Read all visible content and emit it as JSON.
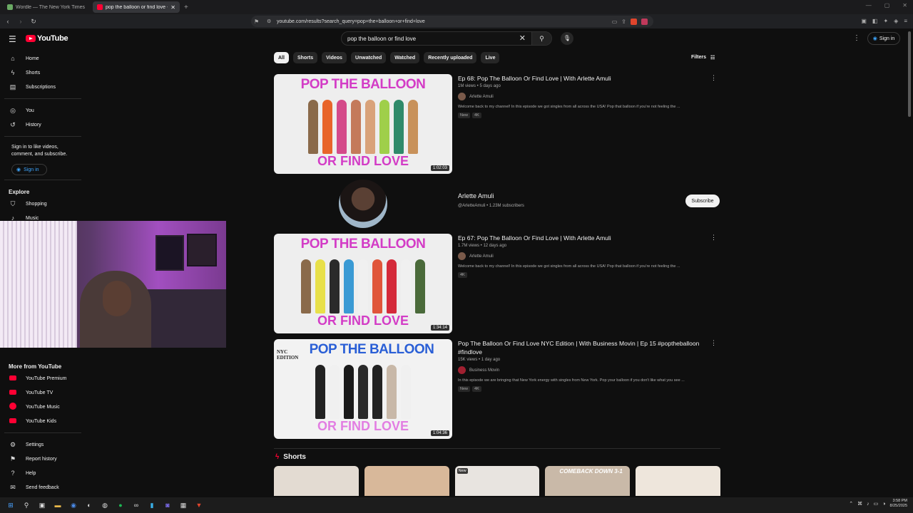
{
  "browser": {
    "tabs": [
      {
        "title": "Wordle — The New York Times",
        "active": false
      },
      {
        "title": "pop the balloon or find love - Yo",
        "active": true
      }
    ],
    "url": "youtube.com/results?search_query=pop+the+balloon+or+find+love"
  },
  "header": {
    "logo_text": "YouTube",
    "search_value": "pop the balloon or find love",
    "sign_in": "Sign in"
  },
  "sidebar": {
    "main": [
      {
        "label": "Home",
        "icon": "home-icon"
      },
      {
        "label": "Shorts",
        "icon": "shorts-icon"
      },
      {
        "label": "Subscriptions",
        "icon": "subscriptions-icon"
      }
    ],
    "you": [
      {
        "label": "You",
        "icon": "user-icon"
      },
      {
        "label": "History",
        "icon": "history-icon"
      }
    ],
    "signin_note": "Sign in to like videos, comment, and subscribe.",
    "signin_btn": "Sign in",
    "explore_title": "Explore",
    "explore": [
      {
        "label": "Shopping",
        "icon": "bag-icon"
      },
      {
        "label": "Music",
        "icon": "music-icon"
      }
    ],
    "more_title": "More from YouTube",
    "more": [
      {
        "label": "YouTube Premium"
      },
      {
        "label": "YouTube TV"
      },
      {
        "label": "YouTube Music"
      },
      {
        "label": "YouTube Kids"
      }
    ],
    "bottom": [
      {
        "label": "Settings",
        "icon": "gear-icon"
      },
      {
        "label": "Report history",
        "icon": "flag-icon"
      },
      {
        "label": "Help",
        "icon": "help-icon"
      },
      {
        "label": "Send feedback",
        "icon": "feedback-icon"
      }
    ]
  },
  "chips": [
    "All",
    "Shorts",
    "Videos",
    "Unwatched",
    "Watched",
    "Recently uploaded",
    "Live"
  ],
  "filters_label": "Filters",
  "results": [
    {
      "thumb_top": "POP THE BALLOON",
      "thumb_bottom": "OR FIND LOVE",
      "duration": "1:02:03",
      "title": "Ep 68: Pop The Balloon Or Find Love | With Arlette Amuli",
      "meta": "1M views • 5 days ago",
      "channel": "Arlette Amuli",
      "desc": "Welcome back to my channel! In this episode we got singles from all across the USA! Pop that balloon if you're not feeling the ...",
      "badges": [
        "New",
        "4K"
      ]
    },
    {
      "thumb_top": "POP THE BALLOON",
      "thumb_bottom": "OR FIND LOVE",
      "duration": "1:34:14",
      "title": "Ep 67: Pop The Balloon Or Find Love | With Arlette Amuli",
      "meta": "1.7M views • 12 days ago",
      "channel": "Arlette Amuli",
      "desc": "Welcome back to my channel! In this episode we got singles from all across the USA! Pop that balloon if you're not feeling the ...",
      "badges": [
        "4K"
      ]
    },
    {
      "thumb_top": "POP THE BALLOON",
      "thumb_bottom": "OR FIND LOVE",
      "thumb_corner": "NYC EDITION",
      "duration": "1:04:36",
      "title": "Pop The Balloon Or Find Love NYC Edition | With Business Movin | Ep 15 #poptheballoon #findlove",
      "meta": "15K views • 1 day ago",
      "channel": "Business Movin",
      "desc": "In this episode we are bringing that New York energy with singles from New York. Pop your balloon if you don't like what you see ...",
      "badges": [
        "New",
        "4K"
      ]
    }
  ],
  "channel_card": {
    "name": "Arlette Amuli",
    "meta": "@ArletteAmuli • 1.23M subscribers",
    "subscribe": "Subscribe"
  },
  "shorts": {
    "title": "Shorts",
    "items": [
      {
        "label": ""
      },
      {
        "label": ""
      },
      {
        "label": "New"
      },
      {
        "label": "COMEBACK DOWN 3-1"
      },
      {
        "label": ""
      }
    ]
  },
  "taskbar": {
    "time": "3:58 PM",
    "date": "8/25/2025"
  },
  "colors": {
    "accent": "#ff0033",
    "link": "#3ea6ff",
    "title_pink": "#d33cc6"
  }
}
